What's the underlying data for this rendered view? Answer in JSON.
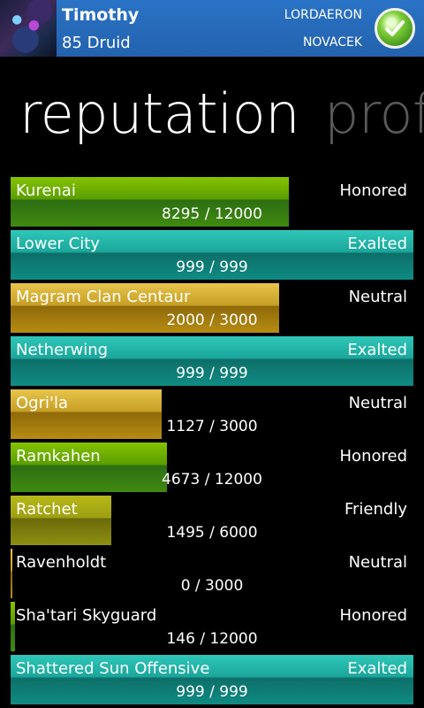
{
  "header": {
    "character_name": "Timothy",
    "character_class": "85 Druid",
    "realm": "LORDAERON",
    "guild": "NOVACEK",
    "check_icon": "checkmark-circle-icon"
  },
  "pivot": {
    "active": "reputation",
    "next": "prof"
  },
  "reputations": [
    {
      "name": "Kurenai",
      "standing": "Honored",
      "value": "8295 / 12000",
      "fill": 0.691,
      "tone": "green"
    },
    {
      "name": "Lower City",
      "standing": "Exalted",
      "value": "999 / 999",
      "fill": 1.0,
      "tone": "teal"
    },
    {
      "name": "Magram Clan Centaur",
      "standing": "Neutral",
      "value": "2000 / 3000",
      "fill": 0.667,
      "tone": "gold"
    },
    {
      "name": "Netherwing",
      "standing": "Exalted",
      "value": "999 / 999",
      "fill": 1.0,
      "tone": "teal"
    },
    {
      "name": "Ogri'la",
      "standing": "Neutral",
      "value": "1127 / 3000",
      "fill": 0.376,
      "tone": "gold"
    },
    {
      "name": "Ramkahen",
      "standing": "Honored",
      "value": "4673 / 12000",
      "fill": 0.389,
      "tone": "green"
    },
    {
      "name": "Ratchet",
      "standing": "Friendly",
      "value": "1495 / 6000",
      "fill": 0.249,
      "tone": "olive"
    },
    {
      "name": "Ravenholdt",
      "standing": "Neutral",
      "value": "0 / 3000",
      "fill": 0.0,
      "tone": "gold"
    },
    {
      "name": "Sha'tari Skyguard",
      "standing": "Honored",
      "value": "146 / 12000",
      "fill": 0.012,
      "tone": "green"
    },
    {
      "name": "Shattered Sun Offensive",
      "standing": "Exalted",
      "value": "999 / 999",
      "fill": 1.0,
      "tone": "teal"
    }
  ]
}
